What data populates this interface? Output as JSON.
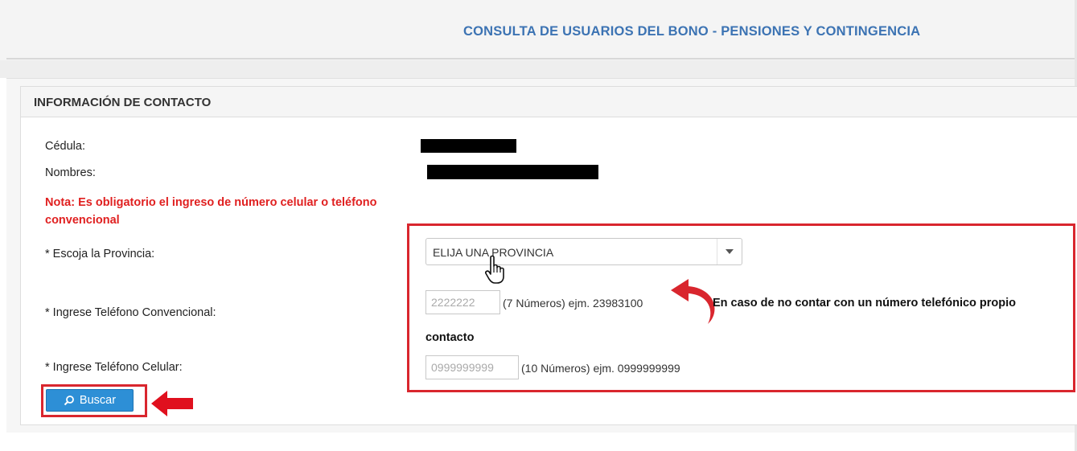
{
  "header": {
    "title": "CONSULTA DE USUARIOS DEL BONO - PENSIONES Y CONTINGENCIA"
  },
  "panel": {
    "title": "INFORMACIÓN DE CONTACTO"
  },
  "form": {
    "cedula_label": "Cédula:",
    "nombres_label": "Nombres:",
    "note": "Nota: Es obligatorio el ingreso de número celular o teléfono convencional",
    "provincia_label": "* Escoja la Provincia:",
    "provincia_selected": "ELIJA UNA PROVINCIA",
    "convencional_label": "* Ingrese Teléfono Convencional:",
    "convencional_placeholder": "2222222",
    "convencional_hint": "(7 Números) ejm. 23983100",
    "celular_label": "* Ingrese Teléfono Celular:",
    "celular_placeholder": "0999999999",
    "celular_hint": "(10 Números) ejm. 0999999999",
    "search_button": "Buscar"
  },
  "annotation": {
    "instruction_line1": "En caso de no contar con un número telefónico propio",
    "instruction_line2": "contacto"
  },
  "colors": {
    "title_blue": "#3c73b3",
    "note_red": "#e02020",
    "highlight_red": "#d9262e",
    "button_blue": "#2d8fd6"
  },
  "icons": {
    "button_icon": "search-icon",
    "cursor": "hand-pointer-icon",
    "arrow_curve": "curved-arrow-icon",
    "arrow_button": "left-arrow-icon"
  }
}
